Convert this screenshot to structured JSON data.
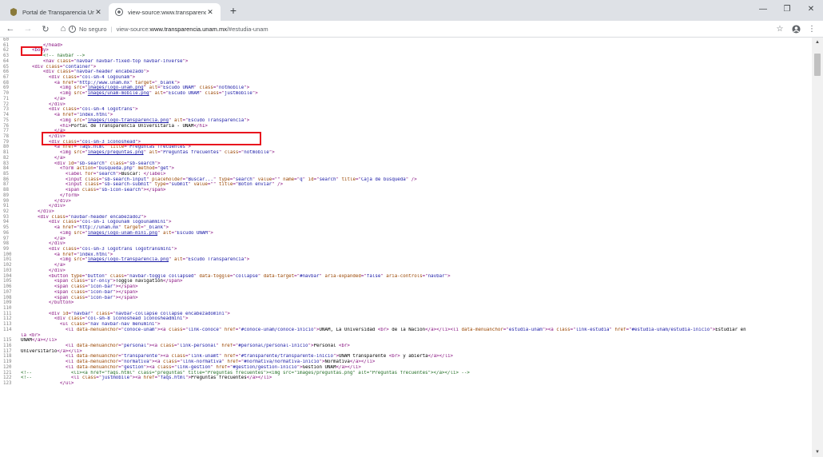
{
  "colors": {
    "highlight": "#e8141e",
    "tag": "#881280",
    "attribute": "#994500",
    "value": "#1a1aa6",
    "comment": "#236e25",
    "line_number": "#808080"
  },
  "tabs": [
    {
      "title": "Portal de Transparencia Universi",
      "favicon": "unam-favicon-icon"
    },
    {
      "title": "view-source:www.transparencia.",
      "favicon": "chrome-icon"
    }
  ],
  "omnibox": {
    "security_label": "No seguro",
    "scheme": "view-source:",
    "host": "www.transparencia.unam.mx",
    "path": "/#estudia-unam"
  },
  "source_lines": [
    {
      "n": "60",
      "html": ""
    },
    {
      "n": "61",
      "html": "        <span class=\"tg\">&lt;/head&gt;</span>"
    },
    {
      "n": "62",
      "html": "    <span class=\"tg\">&lt;body&gt;</span>"
    },
    {
      "n": "63",
      "html": "        <span class=\"cm\">&lt;!-- navbar --&gt;</span>"
    },
    {
      "n": "64",
      "html": "        <span class=\"tg\">&lt;nav <span class=\"at\">class</span>=\"<span class=\"vl\">navbar navbar-fixed-top navbar-inverse</span>\"&gt;</span>"
    },
    {
      "n": "65",
      "html": "    <span class=\"tg\">&lt;div <span class=\"at\">class</span>=\"<span class=\"vl\">container</span>\"&gt;</span>"
    },
    {
      "n": "66",
      "html": "        <span class=\"tg\">&lt;div <span class=\"at\">class</span>=\"<span class=\"vl\">navbar-header encabezado</span>\"&gt;</span>"
    },
    {
      "n": "67",
      "html": "          <span class=\"tg\">&lt;div <span class=\"at\">class</span>=\"<span class=\"vl\">col-sm-4 logounam</span>\"&gt;</span>"
    },
    {
      "n": "68",
      "html": "            <span class=\"tg\">&lt;a <span class=\"at\">href</span>=\"<span class=\"vl\">http://www.unam.mx</span>\" <span class=\"at\">target</span>=\"<span class=\"vl\">_blank</span>\"&gt;</span>"
    },
    {
      "n": "69",
      "html": "              <span class=\"tg\">&lt;img <span class=\"at\">src</span>=\"<span class=\"lk\">images/logo-unam.png</span>\" <span class=\"at\">alt</span>=\"<span class=\"vl\">Escudo UNAM</span>\" <span class=\"at\">class</span>=\"<span class=\"vl\">notmobile</span>\"&gt;</span>"
    },
    {
      "n": "70",
      "html": "              <span class=\"tg\">&lt;img <span class=\"at\">src</span>=\"<span class=\"lk\">images/unam-mobile.png</span>\" <span class=\"at\">alt</span>=\"<span class=\"vl\">Escudo UNAM</span>\" <span class=\"at\">class</span>=\"<span class=\"vl\">justmobile</span>\"&gt;</span>"
    },
    {
      "n": "71",
      "html": "            <span class=\"tg\">&lt;/a&gt;</span>"
    },
    {
      "n": "72",
      "html": "          <span class=\"tg\">&lt;/div&gt;</span>"
    },
    {
      "n": "73",
      "html": "          <span class=\"tg\">&lt;div <span class=\"at\">class</span>=\"<span class=\"vl\">col-sm-4 logotrans</span>\"&gt;</span>"
    },
    {
      "n": "74",
      "html": "            <span class=\"tg\">&lt;a <span class=\"at\">href</span>=\"<span class=\"vl\">index.html</span>\"&gt;</span>"
    },
    {
      "n": "75",
      "html": "              <span class=\"tg\">&lt;img <span class=\"at\">src</span>=\"<span class=\"lk\">images/logo-transparencia.png</span>\" <span class=\"at\">alt</span>=\"<span class=\"vl\">Escudo Transparencia</span>\"&gt;</span>"
    },
    {
      "n": "76",
      "html": "              <span class=\"tg\">&lt;h1&gt;</span>Portal de Transparencia Universitaria - UNAM<span class=\"tg\">&lt;/h1&gt;</span>"
    },
    {
      "n": "77",
      "html": "            <span class=\"tg\">&lt;/a&gt;</span>"
    },
    {
      "n": "78",
      "html": "          <span class=\"tg\">&lt;/div&gt;</span>"
    },
    {
      "n": "79",
      "html": "          <span class=\"tg\">&lt;div <span class=\"at\">class</span>=\"<span class=\"vl\">col-sm-3 iconoshead</span>\"&gt;</span>"
    },
    {
      "n": "80",
      "html": "            <span class=\"tg\">&lt;a <span class=\"at\">href</span>=\"<span class=\"vl\">faqs.html</span>\" <span class=\"at\">title</span>=\"<span class=\"vl\">Preguntas frecuentes</span>\"&gt;</span>"
    },
    {
      "n": "81",
      "html": "              <span class=\"tg\">&lt;img <span class=\"at\">src</span>=\"<span class=\"lk\">images/preguntas.png</span>\" <span class=\"at\">alt</span>=\"<span class=\"vl\">Preguntas frecuentes</span>\" <span class=\"at\">class</span>=\"<span class=\"vl\">notmobile</span>\"&gt;</span>"
    },
    {
      "n": "82",
      "html": "            <span class=\"tg\">&lt;/a&gt;</span>"
    },
    {
      "n": "83",
      "html": "            <span class=\"tg\">&lt;div <span class=\"at\">id</span>=\"<span class=\"vl\">sb-search</span>\" <span class=\"at\">class</span>=\"<span class=\"vl\">sb-search</span>\"&gt;</span>"
    },
    {
      "n": "84",
      "html": "              <span class=\"tg\">&lt;form <span class=\"at\">action</span>=\"<span class=\"vl\">busqueda.php</span>\" <span class=\"at\">method</span>=\"<span class=\"vl\">get</span>\"&gt;</span>"
    },
    {
      "n": "85",
      "html": "                <span class=\"tg\">&lt;label <span class=\"at\">for</span>=\"<span class=\"vl\">search</span>\"&gt;</span>Buscar:<span class=\"tg\"> &lt;/label&gt;</span>"
    },
    {
      "n": "86",
      "html": "                <span class=\"tg\">&lt;input <span class=\"at\">class</span>=\"<span class=\"vl\">sb-search-input</span>\" <span class=\"at\">placeholder</span>=\"<span class=\"vl\">Buscar...</span>\" <span class=\"at\">type</span>=\"<span class=\"vl\">search</span>\" <span class=\"at\">value</span>=\"\" <span class=\"at\">name</span>=\"<span class=\"vl\">q</span>\" <span class=\"at\">id</span>=\"<span class=\"vl\">search</span>\" <span class=\"at\">title</span>=\"<span class=\"vl\">Caja de búsqueda</span>\" /&gt;</span>"
    },
    {
      "n": "87",
      "html": "                <span class=\"tg\">&lt;input <span class=\"at\">class</span>=\"<span class=\"vl\">sb-search-submit</span>\" <span class=\"at\">type</span>=\"<span class=\"vl\">submit</span>\" <span class=\"at\">value</span>=\"\" <span class=\"at\">title</span>=\"<span class=\"vl\">Botón enviar</span>\" /&gt;</span>"
    },
    {
      "n": "88",
      "html": "                <span class=\"tg\">&lt;span <span class=\"at\">class</span>=\"<span class=\"vl\">sb-icon-search</span>\"&gt;&lt;/span&gt;</span>"
    },
    {
      "n": "89",
      "html": "              <span class=\"tg\">&lt;/form&gt;</span>"
    },
    {
      "n": "90",
      "html": "            <span class=\"tg\">&lt;/div&gt;</span>"
    },
    {
      "n": "91",
      "html": "          <span class=\"tg\">&lt;/div&gt;</span>"
    },
    {
      "n": "92",
      "html": "      <span class=\"tg\">&lt;/div&gt;</span>"
    },
    {
      "n": "93",
      "html": "      <span class=\"tg\">&lt;div <span class=\"at\">class</span>=\"<span class=\"vl\">navbar-header encabezado2</span>\"&gt;</span>"
    },
    {
      "n": "94",
      "html": "          <span class=\"tg\">&lt;div <span class=\"at\">class</span>=\"<span class=\"vl\">col-sm-1 logounam logounammini</span>\"&gt;</span>"
    },
    {
      "n": "95",
      "html": "            <span class=\"tg\">&lt;a <span class=\"at\">href</span>=\"<span class=\"vl\">http://unam.mx</span>\" <span class=\"at\">target</span>=\"<span class=\"vl\">_blank</span>\"&gt;</span>"
    },
    {
      "n": "96",
      "html": "              <span class=\"tg\">&lt;img <span class=\"at\">src</span>=\"<span class=\"lk\">images/logo-unam-mini.png</span>\" <span class=\"at\">alt</span>=\"<span class=\"vl\">Escudo UNAM</span>\"&gt;</span>"
    },
    {
      "n": "97",
      "html": "            <span class=\"tg\">&lt;/a&gt;</span>"
    },
    {
      "n": "98",
      "html": "          <span class=\"tg\">&lt;/div&gt;</span>"
    },
    {
      "n": "99",
      "html": "          <span class=\"tg\">&lt;div <span class=\"at\">class</span>=\"<span class=\"vl\">col-sm-3 logotrans logotransmini</span>\"&gt;</span>"
    },
    {
      "n": "100",
      "html": "            <span class=\"tg\">&lt;a <span class=\"at\">href</span>=\"<span class=\"vl\">index.html</span>\"&gt;</span>"
    },
    {
      "n": "101",
      "html": "              <span class=\"tg\">&lt;img <span class=\"at\">src</span>=\"<span class=\"lk\">images/logo-transparencia.png</span>\" <span class=\"at\">alt</span>=\"<span class=\"vl\">Escudo Transparencia</span>\"&gt;</span>"
    },
    {
      "n": "102",
      "html": "            <span class=\"tg\">&lt;/a&gt;</span>"
    },
    {
      "n": "103",
      "html": "          <span class=\"tg\">&lt;/div&gt;</span>"
    },
    {
      "n": "104",
      "html": "          <span class=\"tg\">&lt;button <span class=\"at\">type</span>=\"<span class=\"vl\">button</span>\" <span class=\"at\">class</span>=\"<span class=\"vl\">navbar-toggle collapsed</span>\" <span class=\"at\">data-toggle</span>=\"<span class=\"vl\">collapse</span>\" <span class=\"at\">data-target</span>=\"<span class=\"vl\">#navbar</span>\" <span class=\"at\">aria-expanded</span>=\"<span class=\"vl\">false</span>\" <span class=\"at\">aria-controls</span>=\"<span class=\"vl\">navbar</span>\"&gt;</span>"
    },
    {
      "n": "105",
      "html": "            <span class=\"tg\">&lt;span <span class=\"at\">class</span>=\"<span class=\"vl\">sr-only</span>\"&gt;</span>Toggle navigation<span class=\"tg\">&lt;/span&gt;</span>"
    },
    {
      "n": "106",
      "html": "            <span class=\"tg\">&lt;span <span class=\"at\">class</span>=\"<span class=\"vl\">icon-bar</span>\"&gt;&lt;/span&gt;</span>"
    },
    {
      "n": "107",
      "html": "            <span class=\"tg\">&lt;span <span class=\"at\">class</span>=\"<span class=\"vl\">icon-bar</span>\"&gt;&lt;/span&gt;</span>"
    },
    {
      "n": "108",
      "html": "            <span class=\"tg\">&lt;span <span class=\"at\">class</span>=\"<span class=\"vl\">icon-bar</span>\"&gt;&lt;/span&gt;</span>"
    },
    {
      "n": "109",
      "html": "          <span class=\"tg\">&lt;/button&gt;</span>"
    },
    {
      "n": "110",
      "html": ""
    },
    {
      "n": "111",
      "html": "          <span class=\"tg\">&lt;div <span class=\"at\">id</span>=\"<span class=\"vl\">navbar</span>\" <span class=\"at\">class</span>=\"<span class=\"vl\">navbar-collapse collapse encabezadomini</span>\"&gt;</span>"
    },
    {
      "n": "112",
      "html": "            <span class=\"tg\">&lt;div <span class=\"at\">class</span>=\"<span class=\"vl\">col-sm-8 iconoshead iconosheadmini</span>\"&gt;</span>"
    },
    {
      "n": "113",
      "html": "              <span class=\"tg\">&lt;ul <span class=\"at\">class</span>=\"<span class=\"vl\">nav navbar-nav menumini</span>\"&gt;</span>"
    },
    {
      "n": "114",
      "html": "                <span class=\"tg\">&lt;li <span class=\"at\">data-menuanchor</span>=\"<span class=\"vl\">conoce-unam</span>\"&gt;&lt;a <span class=\"at\">class</span>=\"<span class=\"vl\">link-conoce</span>\" <span class=\"at\">href</span>=\"<span class=\"vl\">#conoce-unam/conoce-inicio</span>\"&gt;</span>UNAM, La Universidad <span class=\"tg\">&lt;br&gt;</span> de la Nación<span class=\"tg\">&lt;/a&gt;&lt;/li&gt;&lt;li <span class=\"at\">data-menuanchor</span>=\"<span class=\"vl\">estudia-unam</span>\"&gt;&lt;a <span class=\"at\">class</span>=\"<span class=\"vl\">link-estudia</span>\" <span class=\"at\">href</span>=\"<span class=\"vl\">#estudia-unam/estudia-inicio</span>\"&gt;</span>Estudiar en"
    },
    {
      "n": "",
      "html": "<span class=\"tg\">la &lt;br&gt;</span>"
    },
    {
      "n": "115",
      "html": "UNAM<span class=\"tg\">&lt;/a&gt;&lt;/li&gt;</span>"
    },
    {
      "n": "116",
      "html": "                <span class=\"tg\">&lt;li <span class=\"at\">data-menuanchor</span>=\"<span class=\"vl\">personal</span>\"&gt;&lt;a <span class=\"at\">class</span>=\"<span class=\"vl\">link-personal</span>\" <span class=\"at\">href</span>=\"<span class=\"vl\">#personal/personal-inicio</span>\"&gt;</span>Personal <span class=\"tg\">&lt;br&gt;</span>"
    },
    {
      "n": "117",
      "html": "Universitario<span class=\"tg\">&lt;/a&gt;&lt;/li&gt;</span>"
    },
    {
      "n": "118",
      "html": "                <span class=\"tg\">&lt;li <span class=\"at\">data-menuanchor</span>=\"<span class=\"vl\">transparente</span>\"&gt;&lt;a <span class=\"at\">class</span>=\"<span class=\"vl\">link-unamt</span>\" <span class=\"at\">href</span>=\"<span class=\"vl\">#transparente/transparente-inicio</span>\"&gt;</span>UNAM transparente <span class=\"tg\">&lt;br&gt;</span> y abierta<span class=\"tg\">&lt;/a&gt;&lt;/li&gt;</span>"
    },
    {
      "n": "119",
      "html": "                <span class=\"tg\">&lt;li <span class=\"at\">data-menuanchor</span>=\"<span class=\"vl\">normativa</span>\"&gt;&lt;a <span class=\"at\">class</span>=\"<span class=\"vl\">link-normativa</span>\" <span class=\"at\">href</span>=\"<span class=\"vl\">#normativa/normativa-inicio</span>\"&gt;</span>Normativa<span class=\"tg\">&lt;/a&gt;&lt;/li&gt;</span>"
    },
    {
      "n": "120",
      "html": "                <span class=\"tg\">&lt;li <span class=\"at\">data-menuanchor</span>=\"<span class=\"vl\">gestion</span>\"&gt;&lt;a <span class=\"at\">class</span>=\"<span class=\"vl\">link-gestion</span>\" <span class=\"at\">href</span>=\"<span class=\"vl\">#gestion/gestion-inicio</span>\"&gt;</span>Gestión UNAM<span class=\"tg\">&lt;/a&gt;&lt;/li&gt;</span>"
    },
    {
      "n": "121",
      "html": "<span class=\"cm\">&lt;!--              &lt;li&gt;&lt;a href=\"faqs.html\" class=\"preguntas\" title=\"Preguntas frecuentes\"&gt;&lt;img src=\"images/preguntas.png\" alt=\"Preguntas frecuentes\"&gt;&lt;/a&gt;&lt;/li&gt; --&gt;</span>"
    },
    {
      "n": "122",
      "html": "<span class=\"cm\">&lt;!--</span>              <span class=\"tg\">&lt;li <span class=\"at\">class</span>=\"<span class=\"vl\">justmobile</span>\"&gt;&lt;a <span class=\"at\">href</span>=\"<span class=\"vl\">faqs.html</span>\"&gt;</span>Preguntas frecuentes<span class=\"tg\">&lt;/a&gt;&lt;/li&gt;</span>"
    },
    {
      "n": "123",
      "html": "              <span class=\"tg\">&lt;/ul&gt;</span>"
    }
  ]
}
